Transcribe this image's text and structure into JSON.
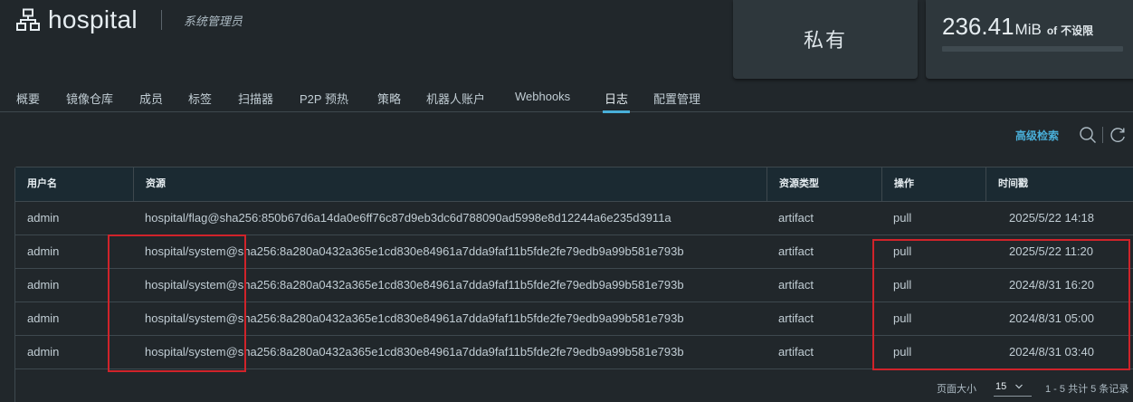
{
  "project": {
    "name": "hospital",
    "role": "系统管理员",
    "icon": "project-tree-icon"
  },
  "cards": {
    "access_level": "私有",
    "quota": {
      "used_value": "236.41",
      "used_unit": "MiB",
      "of_label": "of",
      "limit_label": "不设限",
      "used_fraction": 0.0
    }
  },
  "tabs": [
    {
      "label": "概要"
    },
    {
      "label": "镜像仓库"
    },
    {
      "label": "成员"
    },
    {
      "label": "标签"
    },
    {
      "label": "扫描器"
    },
    {
      "label": "P2P 预热"
    },
    {
      "label": "策略"
    },
    {
      "label": "机器人账户"
    },
    {
      "label": "Webhooks"
    },
    {
      "label": "日志",
      "active": true
    },
    {
      "label": "配置管理"
    }
  ],
  "toolbar": {
    "advanced_search_label": "高级检索",
    "search_icon": "search-icon",
    "refresh_icon": "refresh-icon"
  },
  "table": {
    "columns": [
      "用户名",
      "资源",
      "资源类型",
      "操作",
      "时间戳"
    ],
    "rows": [
      {
        "user": "admin",
        "resource": "hospital/flag@sha256:850b67d6a14da0e6ff76c87d9eb3dc6d788090ad5998e8d12244a6e235d3911a",
        "type": "artifact",
        "op": "pull",
        "time": "2025/5/22 14:18"
      },
      {
        "user": "admin",
        "resource": "hospital/system@sha256:8a280a0432a365e1cd830e84961a7dda9faf11b5fde2fe79edb9a99b581e793b",
        "type": "artifact",
        "op": "pull",
        "time": "2025/5/22 11:20"
      },
      {
        "user": "admin",
        "resource": "hospital/system@sha256:8a280a0432a365e1cd830e84961a7dda9faf11b5fde2fe79edb9a99b581e793b",
        "type": "artifact",
        "op": "pull",
        "time": "2024/8/31 16:20"
      },
      {
        "user": "admin",
        "resource": "hospital/system@sha256:8a280a0432a365e1cd830e84961a7dda9faf11b5fde2fe79edb9a99b581e793b",
        "type": "artifact",
        "op": "pull",
        "time": "2024/8/31 05:00"
      },
      {
        "user": "admin",
        "resource": "hospital/system@sha256:8a280a0432a365e1cd830e84961a7dda9faf11b5fde2fe79edb9a99b581e793b",
        "type": "artifact",
        "op": "pull",
        "time": "2024/8/31 03:40"
      }
    ]
  },
  "pagination": {
    "page_size_label": "页面大小",
    "page_size": "15",
    "summary": "1 - 5 共计 5 条记录"
  },
  "colors": {
    "accent": "#49afd9",
    "background": "#21272b",
    "highlight_box": "#d0232a"
  }
}
